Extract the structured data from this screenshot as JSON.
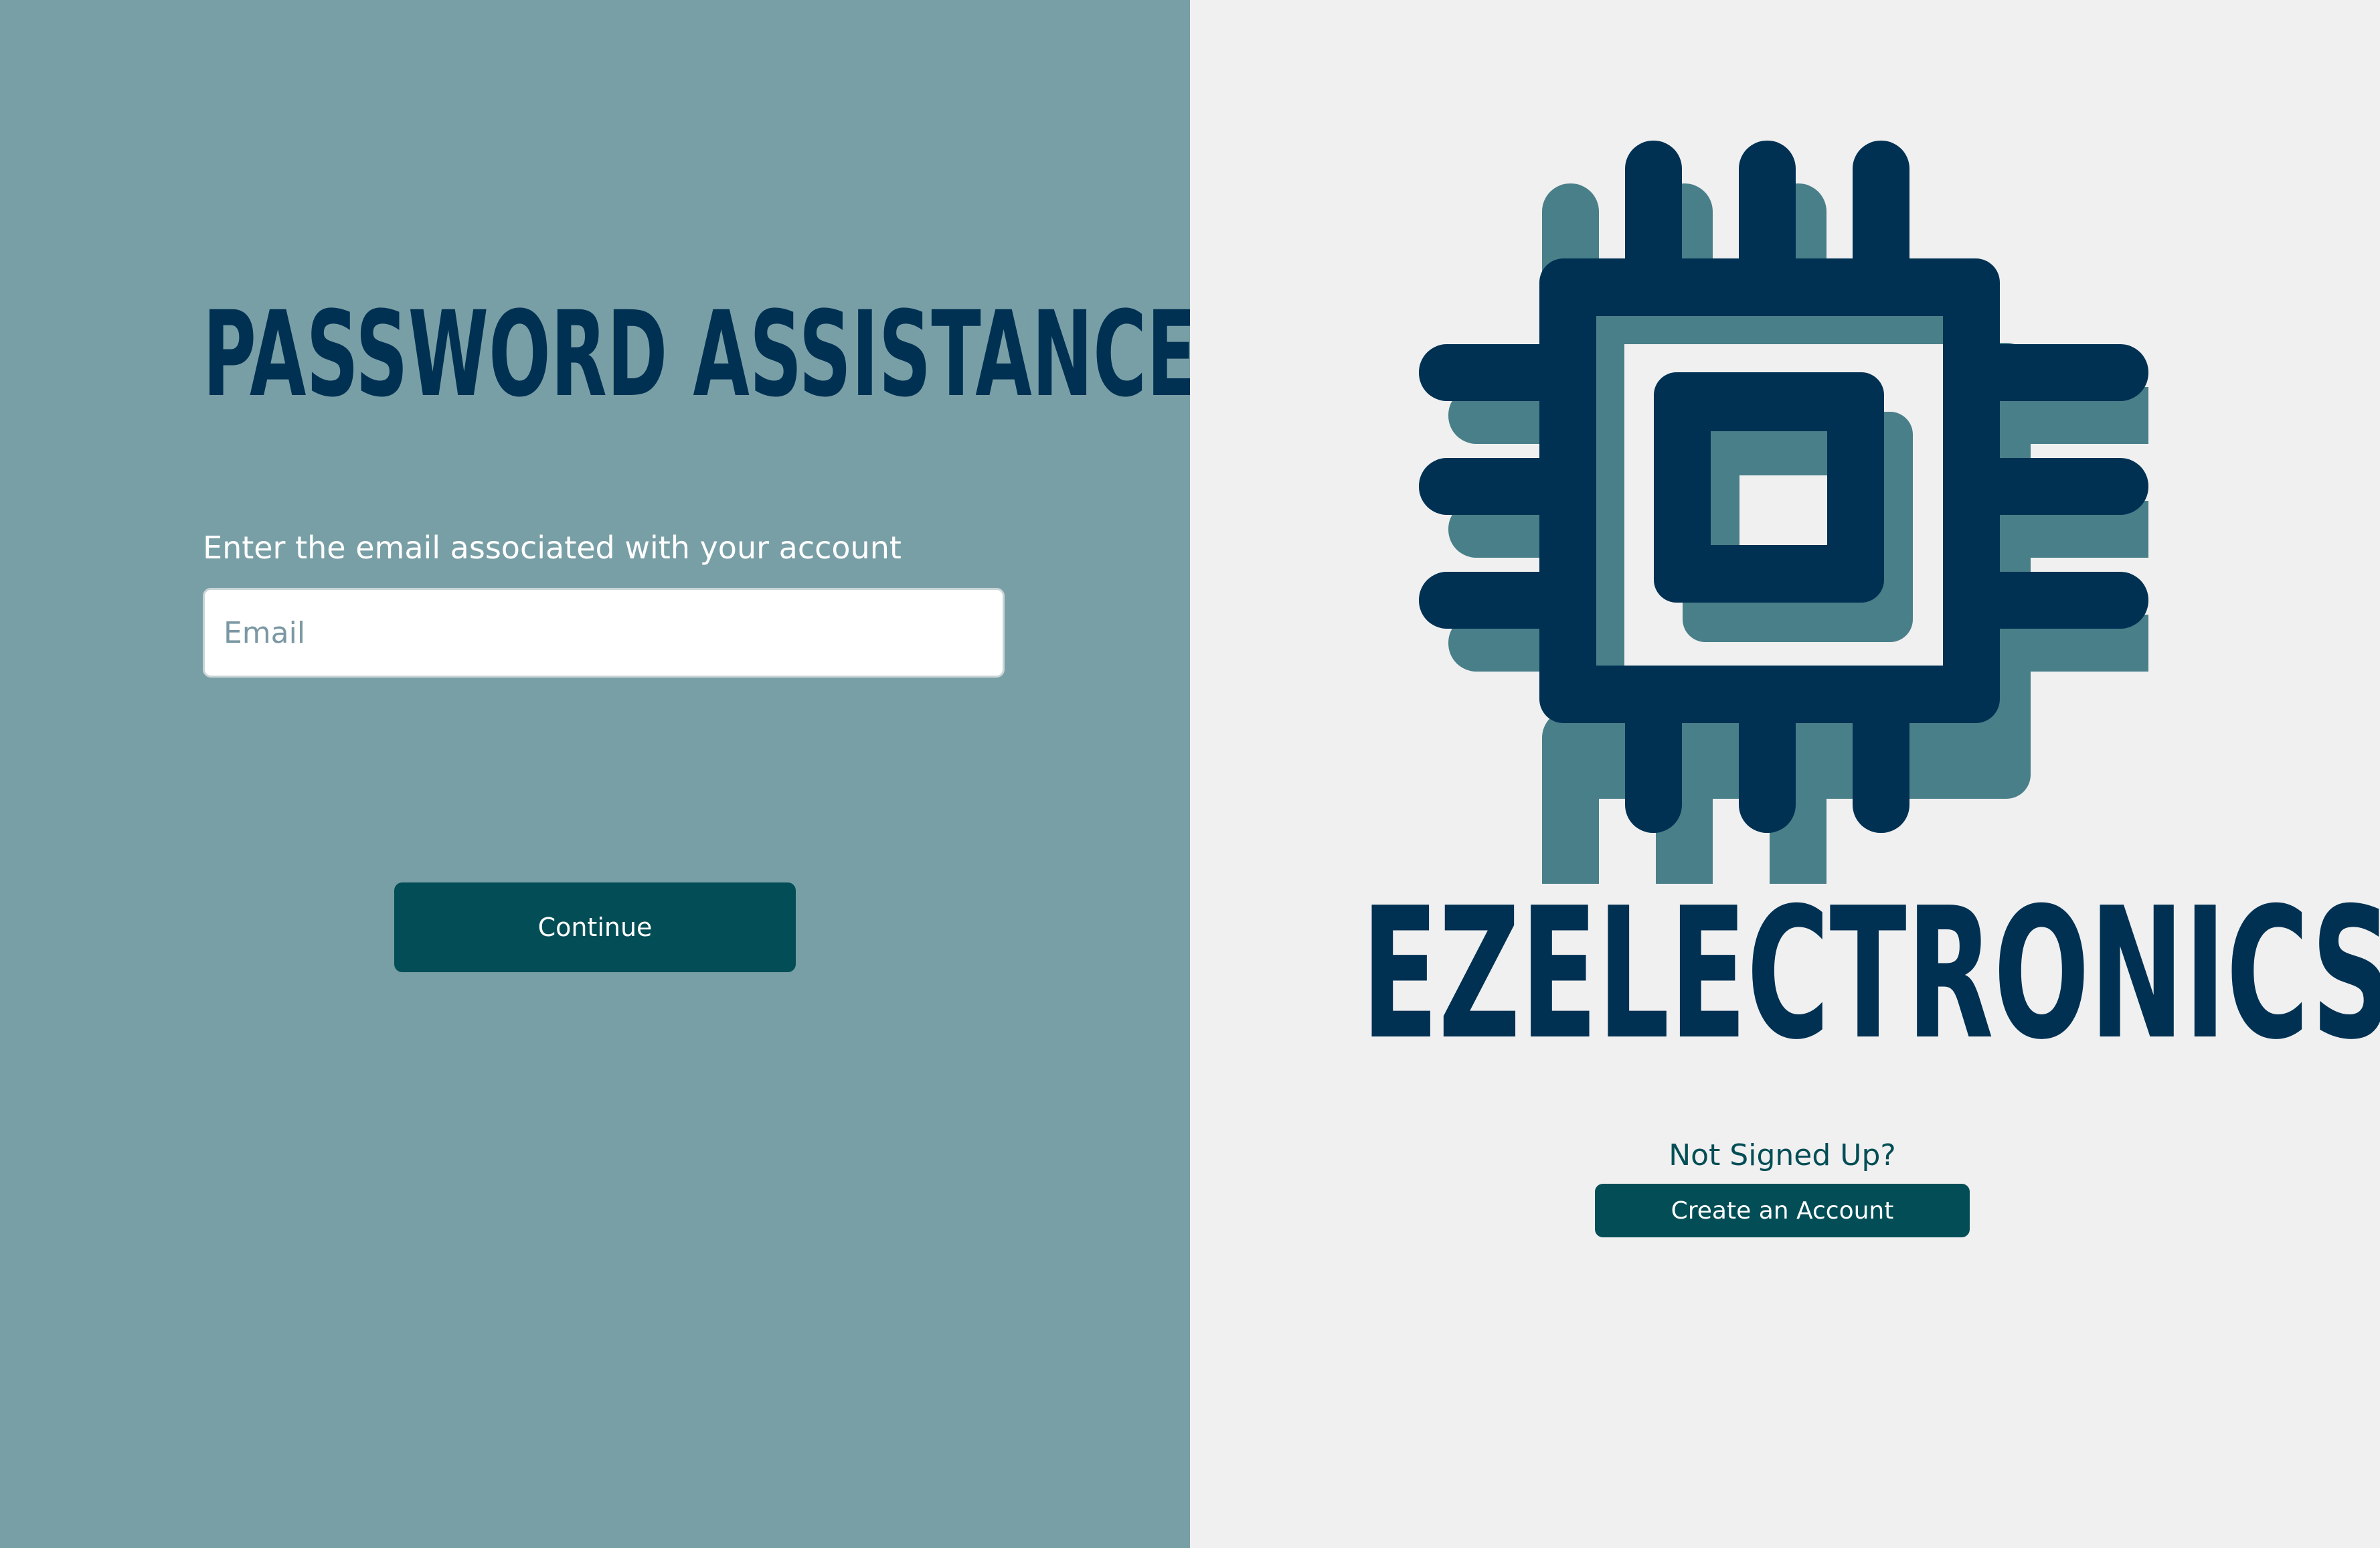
{
  "password_section": {
    "title": "PASSWORD ASSISTANCE",
    "email_label": "Enter the email associated with your account",
    "email_placeholder": "Email",
    "continue_label": "Continue"
  },
  "brand": {
    "logo_icon": "microchip-icon",
    "name": "EZELECTRONICS"
  },
  "signup": {
    "prompt": "Not Signed Up?",
    "create_account_label": "Create an Account"
  },
  "colors": {
    "left_background": "#799fa6",
    "right_background": "#f0f0f0",
    "title_navy": "#003153",
    "button_teal": "#034e56",
    "logo_shadow_teal": "#497f89"
  }
}
